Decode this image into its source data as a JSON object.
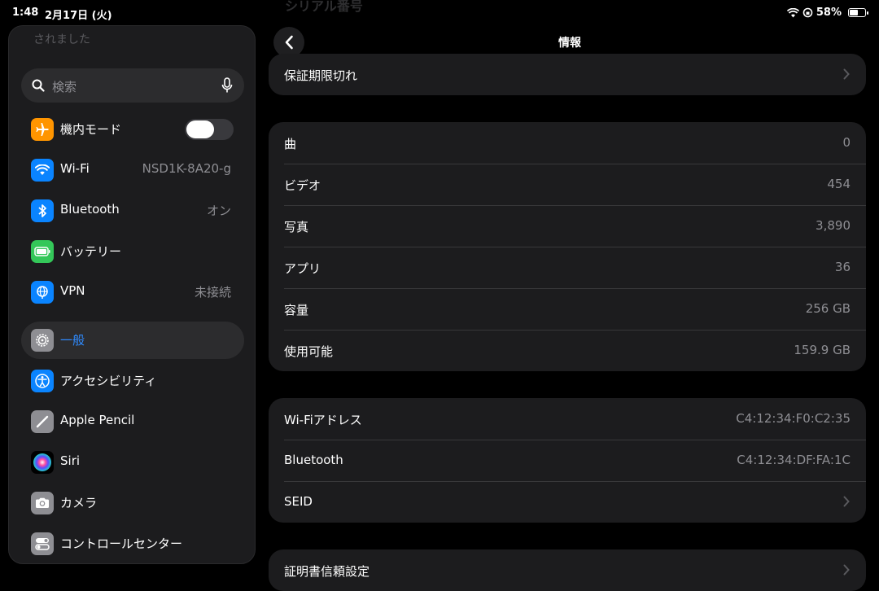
{
  "status": {
    "time": "1:48",
    "date": "2月17日 (火)",
    "battery": "58%",
    "battery_level": 0.58
  },
  "sidebar": {
    "faded_text": "されました",
    "search_placeholder": "検索",
    "items": [
      {
        "label": "機内モード",
        "icon": "airplane-icon",
        "color": "#ff9500",
        "toggle": false
      },
      {
        "label": "Wi-Fi",
        "value": "NSD1K-8A20-g",
        "icon": "wifi-icon",
        "color": "#0a84ff"
      },
      {
        "label": "Bluetooth",
        "value": "オン",
        "icon": "bluetooth-icon",
        "color": "#0a84ff"
      },
      {
        "label": "バッテリー",
        "icon": "battery-icon",
        "color": "#34c759"
      },
      {
        "label": "VPN",
        "value": "未接続",
        "icon": "vpn-globe-icon",
        "color": "#0a84ff"
      },
      {
        "label": "一般",
        "icon": "gear-icon",
        "color": "#8e8e93",
        "selected": true
      },
      {
        "label": "アクセシビリティ",
        "icon": "accessibility-icon",
        "color": "#0a84ff"
      },
      {
        "label": "Apple Pencil",
        "icon": "pencil-icon",
        "color": "#8e8e93"
      },
      {
        "label": "Siri",
        "icon": "siri-icon",
        "color": "#000000"
      },
      {
        "label": "カメラ",
        "icon": "camera-icon",
        "color": "#8e8e93"
      },
      {
        "label": "コントロールセンター",
        "icon": "control-center-icon",
        "color": "#8e8e93"
      }
    ]
  },
  "detail": {
    "title": "情報",
    "blurred_header": "シリアル番号",
    "warranty": {
      "label": "保証期限切れ"
    },
    "stats": [
      {
        "label": "曲",
        "value": "0"
      },
      {
        "label": "ビデオ",
        "value": "454"
      },
      {
        "label": "写真",
        "value": "3,890"
      },
      {
        "label": "アプリ",
        "value": "36"
      },
      {
        "label": "容量",
        "value": "256 GB"
      },
      {
        "label": "使用可能",
        "value": "159.9 GB"
      }
    ],
    "network": [
      {
        "label": "Wi-Fiアドレス",
        "value": "C4:12:34:F0:C2:35"
      },
      {
        "label": "Bluetooth",
        "value": "C4:12:34:DF:FA:1C"
      },
      {
        "label": "SEID"
      }
    ],
    "certificate": {
      "label": "証明書信頼設定"
    }
  }
}
